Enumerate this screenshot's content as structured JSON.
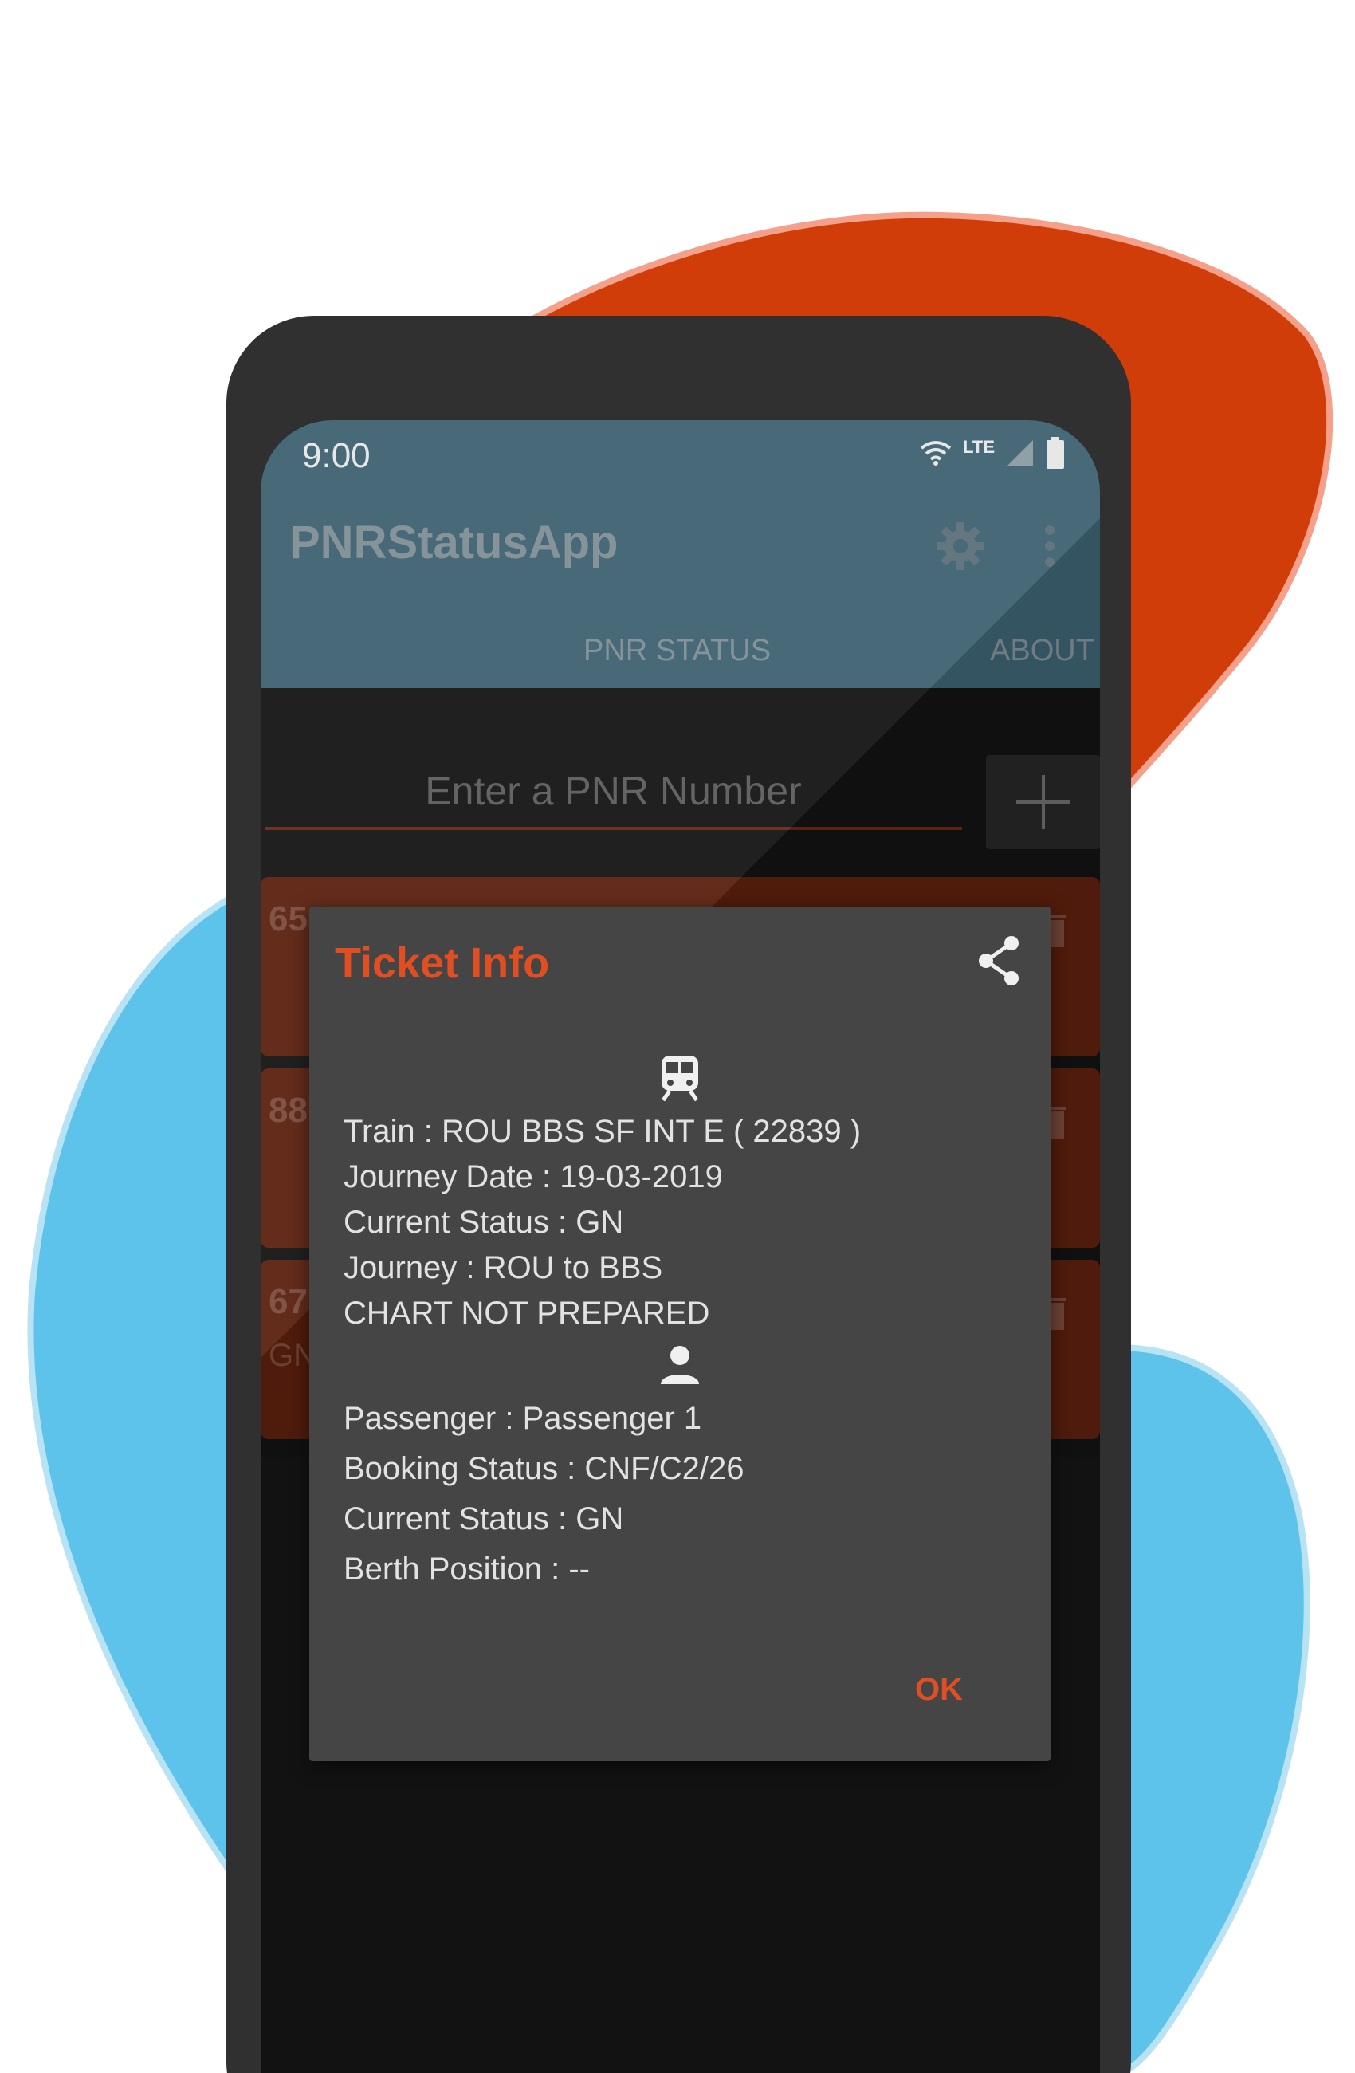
{
  "colors": {
    "accent": "#e04e21",
    "appbar": "#3c6070",
    "dialog_bg": "#454545",
    "card_bg": "#5a1f0d",
    "blob_orange": "#d13d08",
    "blob_blue": "#5ec3ea"
  },
  "status_bar": {
    "time": "9:00",
    "network": "LTE"
  },
  "app_bar": {
    "title": "PNRStatusApp",
    "settings_icon": "gear-icon",
    "more_icon": "more-vert-icon"
  },
  "tabs": [
    {
      "label": "PNR STATUS"
    },
    {
      "label": "ABOUT"
    }
  ],
  "search": {
    "placeholder": "Enter a PNR Number",
    "add_icon": "plus-icon"
  },
  "pnr_cards": [
    {
      "number": "65",
      "sub": ""
    },
    {
      "number": "88",
      "sub": ""
    },
    {
      "number": "67",
      "sub": "GN"
    }
  ],
  "dialog": {
    "title": "Ticket Info",
    "share_icon": "share-icon",
    "train_icon": "train-icon",
    "passenger_icon": "person-icon",
    "train_info": [
      "Train : ROU BBS SF INT E ( 22839 )",
      "Journey Date : 19-03-2019",
      "Current Status : GN",
      "Journey : ROU to BBS",
      "CHART NOT PREPARED"
    ],
    "passenger_info": [
      "Passenger : Passenger 1",
      "Booking Status : CNF/C2/26",
      "Current Status : GN",
      "Berth Position : --"
    ],
    "ok_label": "OK"
  }
}
